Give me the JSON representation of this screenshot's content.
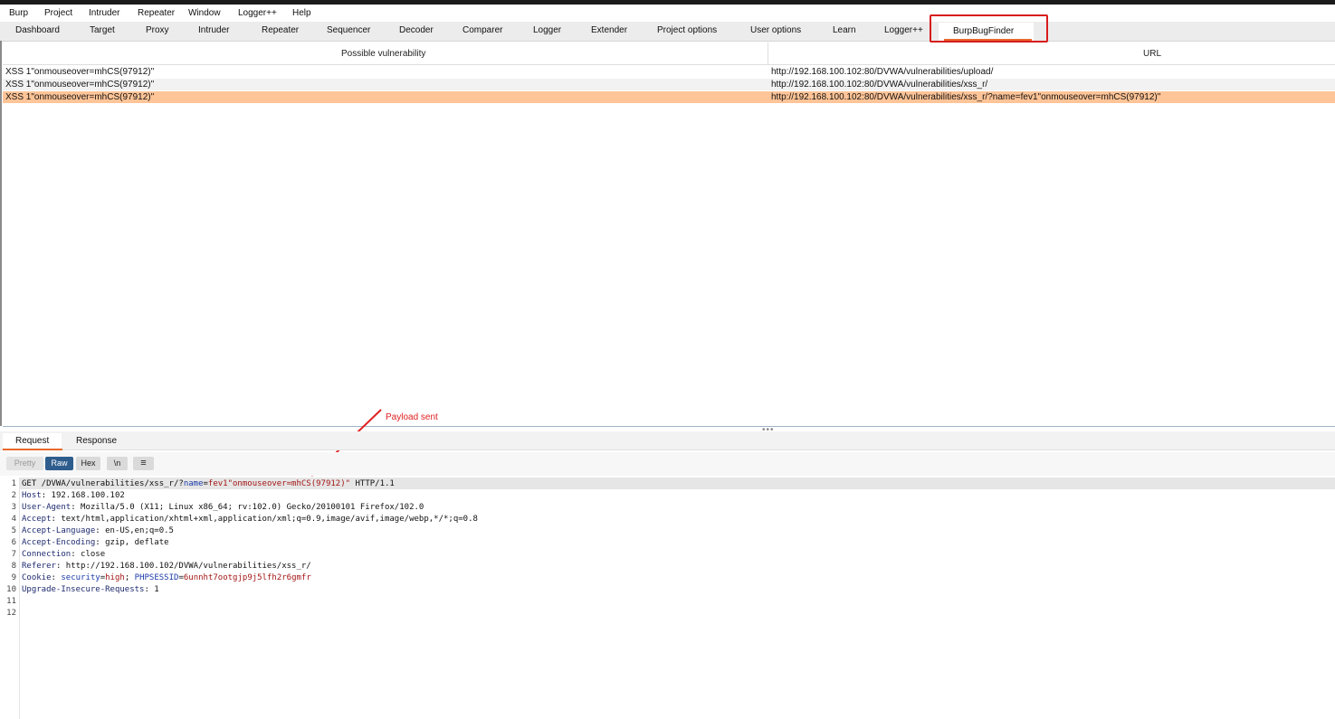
{
  "menu": [
    "Burp",
    "Project",
    "Intruder",
    "Repeater",
    "Window",
    "Logger++",
    "Help"
  ],
  "tabs": [
    "Dashboard",
    "Target",
    "Proxy",
    "Intruder",
    "Repeater",
    "Sequencer",
    "Decoder",
    "Comparer",
    "Logger",
    "Extender",
    "Project options",
    "User options",
    "Learn",
    "Logger++",
    "BurpBugFinder"
  ],
  "active_tab": "BurpBugFinder",
  "table": {
    "headers": [
      "Possible vulnerability",
      "URL"
    ],
    "rows": [
      {
        "vuln": "XSS 1\"onmouseover=mhCS(97912)\"",
        "url": "http://192.168.100.102:80/DVWA/vulnerabilities/upload/"
      },
      {
        "vuln": "XSS 1\"onmouseover=mhCS(97912)\"",
        "url": "http://192.168.100.102:80/DVWA/vulnerabilities/xss_r/"
      },
      {
        "vuln": "XSS 1\"onmouseover=mhCS(97912)\"",
        "url": "http://192.168.100.102:80/DVWA/vulnerabilities/xss_r/?name=fev1\"onmouseover=mhCS(97912)\""
      }
    ],
    "selected_row": 2
  },
  "editor": {
    "subtabs": [
      "Request",
      "Response"
    ],
    "active_subtab": "Request",
    "buttons": {
      "pretty": "Pretty",
      "raw": "Raw",
      "hex": "Hex",
      "newline": "\\n",
      "menu_glyph": "≡"
    },
    "active_mode": "Raw",
    "line_numbers": [
      "1",
      "2",
      "3",
      "4",
      "5",
      "6",
      "7",
      "8",
      "9",
      "10",
      "11",
      "12"
    ],
    "request_line": {
      "method_path": "GET /DVWA/vulnerabilities/xss_r/?",
      "param_name": "name",
      "eq": "=",
      "param_value": "fev1\"onmouseover=mhCS(97912)\"",
      "protocol": " HTTP/1.1"
    },
    "headers": [
      {
        "name": "Host",
        "value": " 192.168.100.102"
      },
      {
        "name": "User-Agent",
        "value": " Mozilla/5.0 (X11; Linux x86_64; rv:102.0) Gecko/20100101 Firefox/102.0"
      },
      {
        "name": "Accept",
        "value": " text/html,application/xhtml+xml,application/xml;q=0.9,image/avif,image/webp,*/*;q=0.8"
      },
      {
        "name": "Accept-Language",
        "value": " en-US,en;q=0.5"
      },
      {
        "name": "Accept-Encoding",
        "value": " gzip, deflate"
      },
      {
        "name": "Connection",
        "value": " close"
      },
      {
        "name": "Referer",
        "value": " http://192.168.100.102/DVWA/vulnerabilities/xss_r/"
      }
    ],
    "cookie": {
      "name": "Cookie",
      "sep": ": ",
      "k1": "security",
      "v1": "high",
      "semi": "; ",
      "k2": "PHPSESSID",
      "v2": "6unnht7ootgjp9j5lfh2r6gmfr"
    },
    "last_header": {
      "name": "Upgrade-Insecure-Requests",
      "value": " 1"
    }
  },
  "annotation": {
    "text": "Payload sent",
    "color": "#e02020"
  },
  "colors": {
    "accent": "#e8692c",
    "selected_row": "#ffc497",
    "highlight_box": "#d81c1c",
    "raw_button": "#2e5d8d"
  }
}
